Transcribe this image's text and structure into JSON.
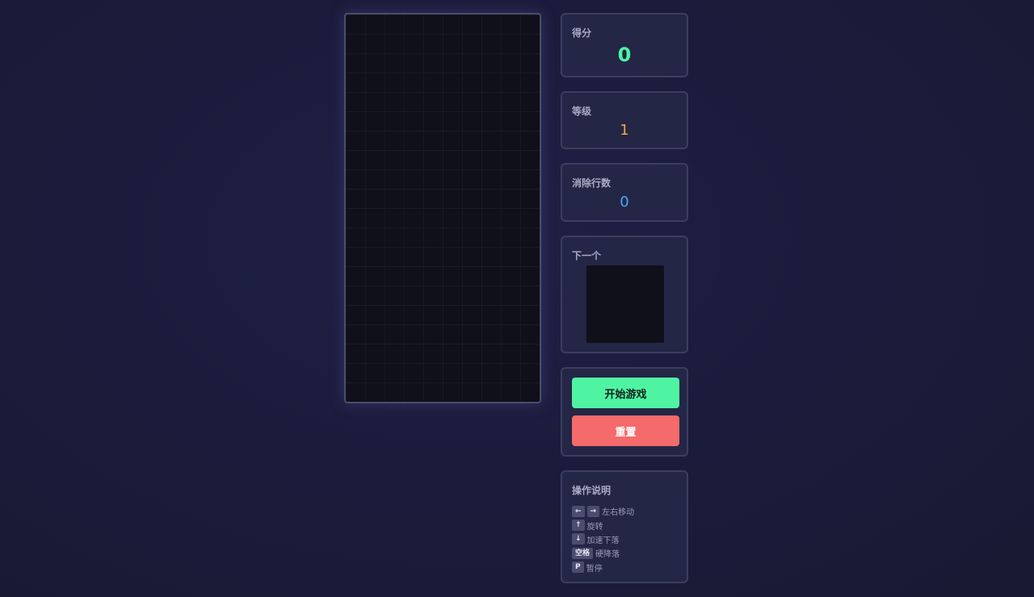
{
  "board": {
    "columns": 10,
    "rows": 20
  },
  "score": {
    "label": "得分",
    "value": "0"
  },
  "level": {
    "label": "等级",
    "value": "1"
  },
  "lines": {
    "label": "消除行数",
    "value": "0"
  },
  "next": {
    "label": "下一个"
  },
  "actions": {
    "start_label": "开始游戏",
    "reset_label": "重置"
  },
  "help": {
    "title": "操作说明",
    "items": [
      {
        "keys": [
          "←",
          "→"
        ],
        "text": "左右移动"
      },
      {
        "keys": [
          "↑"
        ],
        "text": "旋转"
      },
      {
        "keys": [
          "↓"
        ],
        "text": "加速下落"
      },
      {
        "keys": [
          "空格"
        ],
        "text": "硬降落"
      },
      {
        "keys": [
          "P"
        ],
        "text": "暂停"
      }
    ]
  },
  "colors": {
    "score": "#4ff4a3",
    "level": "#f2a444",
    "lines": "#4aa8f5",
    "start_button": "#4ff4a3",
    "reset_button": "#f56a6a"
  }
}
